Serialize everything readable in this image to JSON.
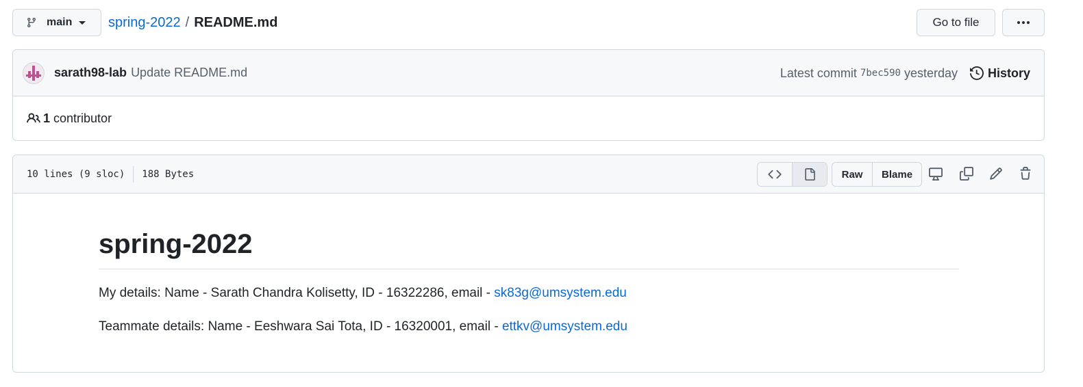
{
  "branch": {
    "name": "main",
    "icon": "git-branch-icon"
  },
  "breadcrumb": {
    "repo": "spring-2022",
    "separator": "/",
    "file": "README.md"
  },
  "header_actions": {
    "goto_label": "Go to file",
    "more_icon": "kebab-horizontal-icon"
  },
  "commit": {
    "author": "sarath98-lab",
    "message": "Update README.md",
    "latest_label": "Latest commit",
    "sha": "7bec590",
    "time": "yesterday",
    "history_label": "History"
  },
  "contributors": {
    "count": "1",
    "label": "contributor"
  },
  "file": {
    "lines": "10 lines (9 sloc)",
    "size": "188 Bytes",
    "raw_label": "Raw",
    "blame_label": "Blame"
  },
  "readme": {
    "title": "spring-2022",
    "p1_text": "My details: Name - Sarath Chandra Kolisetty, ID - 16322286, email - ",
    "p1_email": "sk83g@umsystem.edu",
    "p2_text": "Teammate details: Name - Eeshwara Sai Tota, ID - 16320001, email - ",
    "p2_email": "ettkv@umsystem.edu"
  },
  "colors": {
    "link": "#0969da",
    "border": "#d0d7de",
    "header_bg": "#f6f8fa"
  }
}
